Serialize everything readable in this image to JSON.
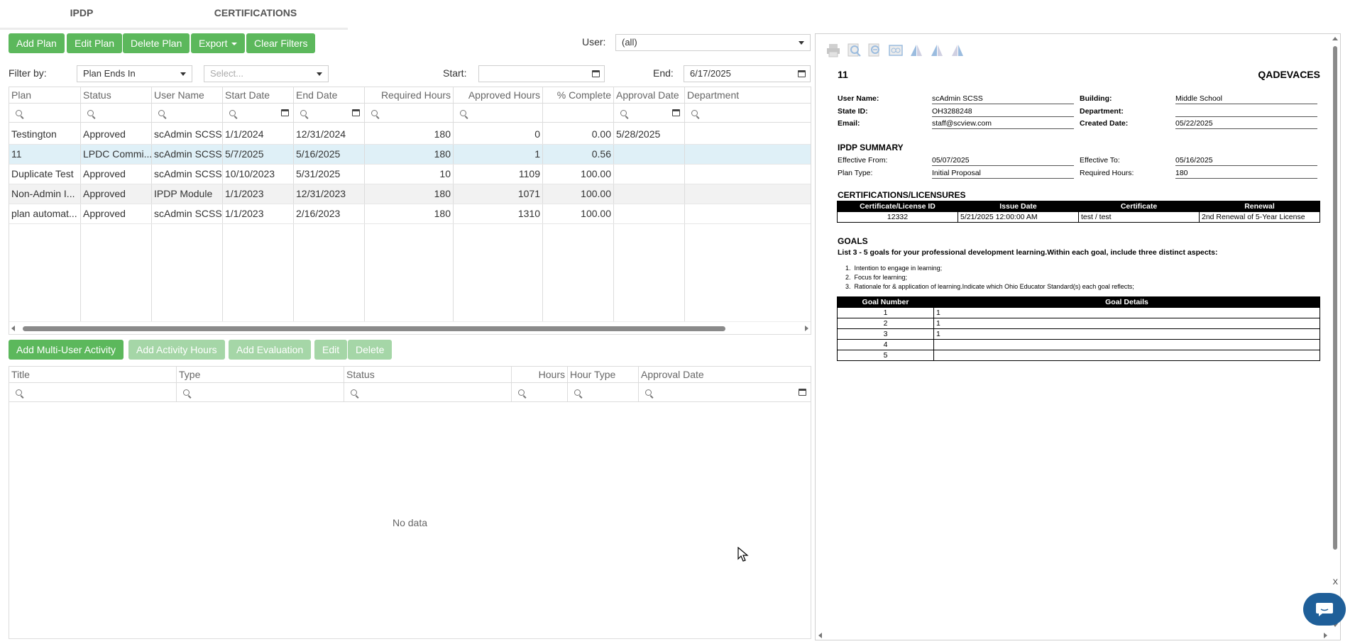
{
  "tabs": [
    {
      "label": "IPDP",
      "active": true
    },
    {
      "label": "CERTIFICATIONS",
      "active": false
    }
  ],
  "toolbar": {
    "add_plan": "Add Plan",
    "edit_plan": "Edit Plan",
    "delete_plan": "Delete Plan",
    "export": "Export",
    "clear_filters": "Clear Filters"
  },
  "user_filter": {
    "label": "User:",
    "value": "(all)"
  },
  "filter": {
    "label": "Filter by:",
    "value": "Plan Ends In",
    "second_placeholder": "Select...",
    "start_label": "Start:",
    "start_value": "",
    "end_label": "End:",
    "end_value": "6/17/2025"
  },
  "plans_grid": {
    "columns": [
      "Plan",
      "Status",
      "User Name",
      "Start Date",
      "End Date",
      "Required Hours",
      "Approved Hours",
      "% Complete",
      "Approval Date",
      "Department"
    ],
    "rows": [
      [
        "Testington",
        "Approved",
        "scAdmin SCSS",
        "1/1/2024",
        "12/31/2024",
        "180",
        "0",
        "0.00",
        "5/28/2025",
        ""
      ],
      [
        "11",
        "LPDC Commi...",
        "scAdmin SCSS",
        "5/7/2025",
        "5/16/2025",
        "180",
        "1",
        "0.56",
        "",
        ""
      ],
      [
        "Duplicate Test",
        "Approved",
        "scAdmin SCSS",
        "10/10/2023",
        "5/31/2025",
        "10",
        "1109",
        "100.00",
        "",
        ""
      ],
      [
        "Non-Admin I...",
        "Approved",
        "IPDP Module",
        "1/1/2023",
        "12/31/2023",
        "180",
        "1071",
        "100.00",
        "",
        ""
      ],
      [
        "plan automat...",
        "Approved",
        "scAdmin SCSS",
        "1/1/2023",
        "2/16/2023",
        "180",
        "1310",
        "100.00",
        "",
        ""
      ]
    ],
    "selected_row": 1
  },
  "activity_toolbar": {
    "add_multi": "Add Multi-User Activity",
    "add_hours": "Add Activity Hours",
    "add_eval": "Add Evaluation",
    "edit": "Edit",
    "delete": "Delete"
  },
  "activity_grid": {
    "columns": [
      "Title",
      "Type",
      "Status",
      "Hours",
      "Hour Type",
      "Approval Date"
    ],
    "empty": "No data"
  },
  "report": {
    "plan_name": "11",
    "district": "QADEVACES",
    "user_name_label": "User Name:",
    "user_name": "scAdmin SCSS",
    "state_id_label": "State ID:",
    "state_id": "OH3288248",
    "email_label": "Email:",
    "email": "staff@scview.com",
    "building_label": "Building:",
    "building": "Middle School",
    "department_label": "Department:",
    "department": "",
    "created_label": "Created Date:",
    "created": "05/22/2025",
    "summary_title": "IPDP SUMMARY",
    "eff_from_label": "Effective From:",
    "eff_from": "05/07/2025",
    "plan_type_label": "Plan Type:",
    "plan_type": "Initial Proposal",
    "eff_to_label": "Effective To:",
    "eff_to": "05/16/2025",
    "req_hours_label": "Required Hours:",
    "req_hours": "180",
    "cert_title": "CERTIFICATIONS/LICENSURES",
    "cert_cols": [
      "Certificate/License ID",
      "Issue Date",
      "Certificate",
      "Renewal"
    ],
    "cert_row": [
      "12332",
      "5/21/2025 12:00:00 AM",
      "test / test",
      "2nd Renewal of 5-Year License"
    ],
    "goals_title": "GOALS",
    "goals_intro": "List 3 - 5 goals for your professional development learning.Within each goal, include three distinct aspects:",
    "goals_list": [
      "Intention to engage in learning;",
      "Focus for learning;",
      "Rationale for & application of learning.Indicate which Ohio Educator Standard(s) each goal reflects;"
    ],
    "goal_cols": [
      "Goal Number",
      "Goal Details"
    ],
    "goal_rows": [
      [
        "1",
        "1"
      ],
      [
        "2",
        "1"
      ],
      [
        "3",
        "1"
      ],
      [
        "4",
        ""
      ],
      [
        "5",
        ""
      ]
    ]
  },
  "close_x": "X"
}
